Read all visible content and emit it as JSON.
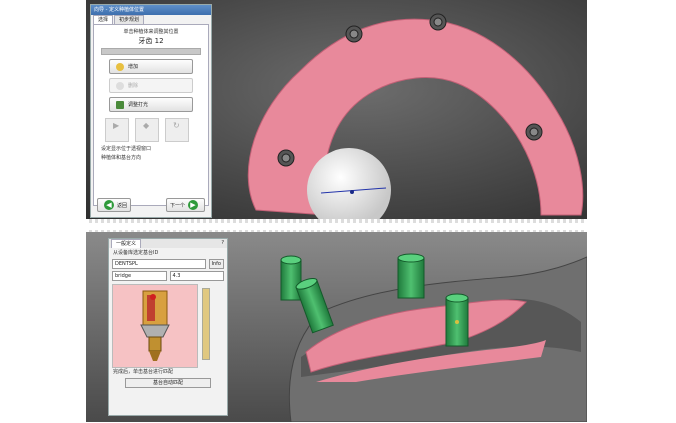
{
  "top": {
    "window_title": "向导 - 定义种植体位置",
    "tabs": [
      "选择",
      "初步规划"
    ],
    "instruction": "单击种植体来调整其位置",
    "tooth_label": "牙齿 12",
    "buttons": {
      "add": "增加",
      "remove": "删除",
      "adjust": "调整打光"
    },
    "grid_labels": [
      "",
      "",
      ""
    ],
    "notes": [
      "设定显示位于透视窗口",
      "种植体和基台方向"
    ],
    "nav": {
      "back": "返回",
      "next": "下一个"
    }
  },
  "bottom": {
    "panel_title": "一般定义",
    "help": "?",
    "section_label": "从设备库选定基台ID",
    "manufacturer": "DENTSPL",
    "manufacturer_btn": "Info",
    "type": "bridge",
    "size": "4.3",
    "status": "完成后，单击基台进行匹配",
    "confirm": "基台自动匹配"
  },
  "colors": {
    "gum": "#e88a9c",
    "abutment": "#2e9a4f",
    "jaw": "#6f6f6f",
    "accent_green": "#2e9a3a"
  }
}
